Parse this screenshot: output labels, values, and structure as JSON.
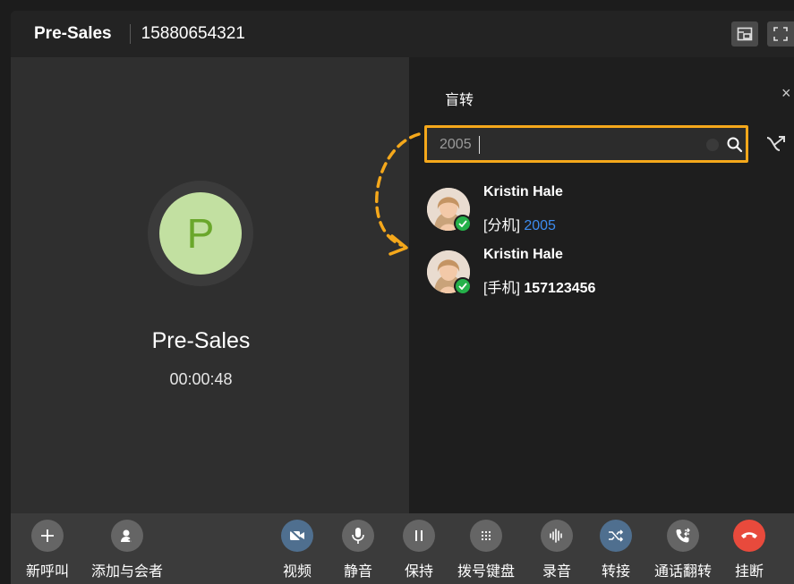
{
  "header": {
    "queue_name": "Pre-Sales",
    "phone_number": "15880654321"
  },
  "call": {
    "avatar_letter": "P",
    "name": "Pre-Sales",
    "duration": "00:00:48"
  },
  "transfer_panel": {
    "title": "盲转",
    "close_label": "×",
    "search_value": "2005",
    "results": [
      {
        "name": "Kristin Hale",
        "type_label": "[分机]",
        "number": "2005"
      },
      {
        "name": "Kristin Hale",
        "type_label": "[手机]",
        "number": "157123456"
      }
    ]
  },
  "controls": {
    "new_call": "新呼叫",
    "add_participant": "添加与会者",
    "video": "视频",
    "mute": "静音",
    "hold": "保持",
    "dialpad": "拨号键盘",
    "record": "录音",
    "transfer": "转接",
    "flip": "通话翻转",
    "hangup": "挂断"
  },
  "colors": {
    "highlight": "#f5a81b",
    "avatar_bg": "#c2e0a1",
    "avatar_fg": "#6aa72b",
    "hangup": "#e84a3c",
    "status_online": "#25b14a",
    "extension_blue": "#3d8cf0"
  }
}
